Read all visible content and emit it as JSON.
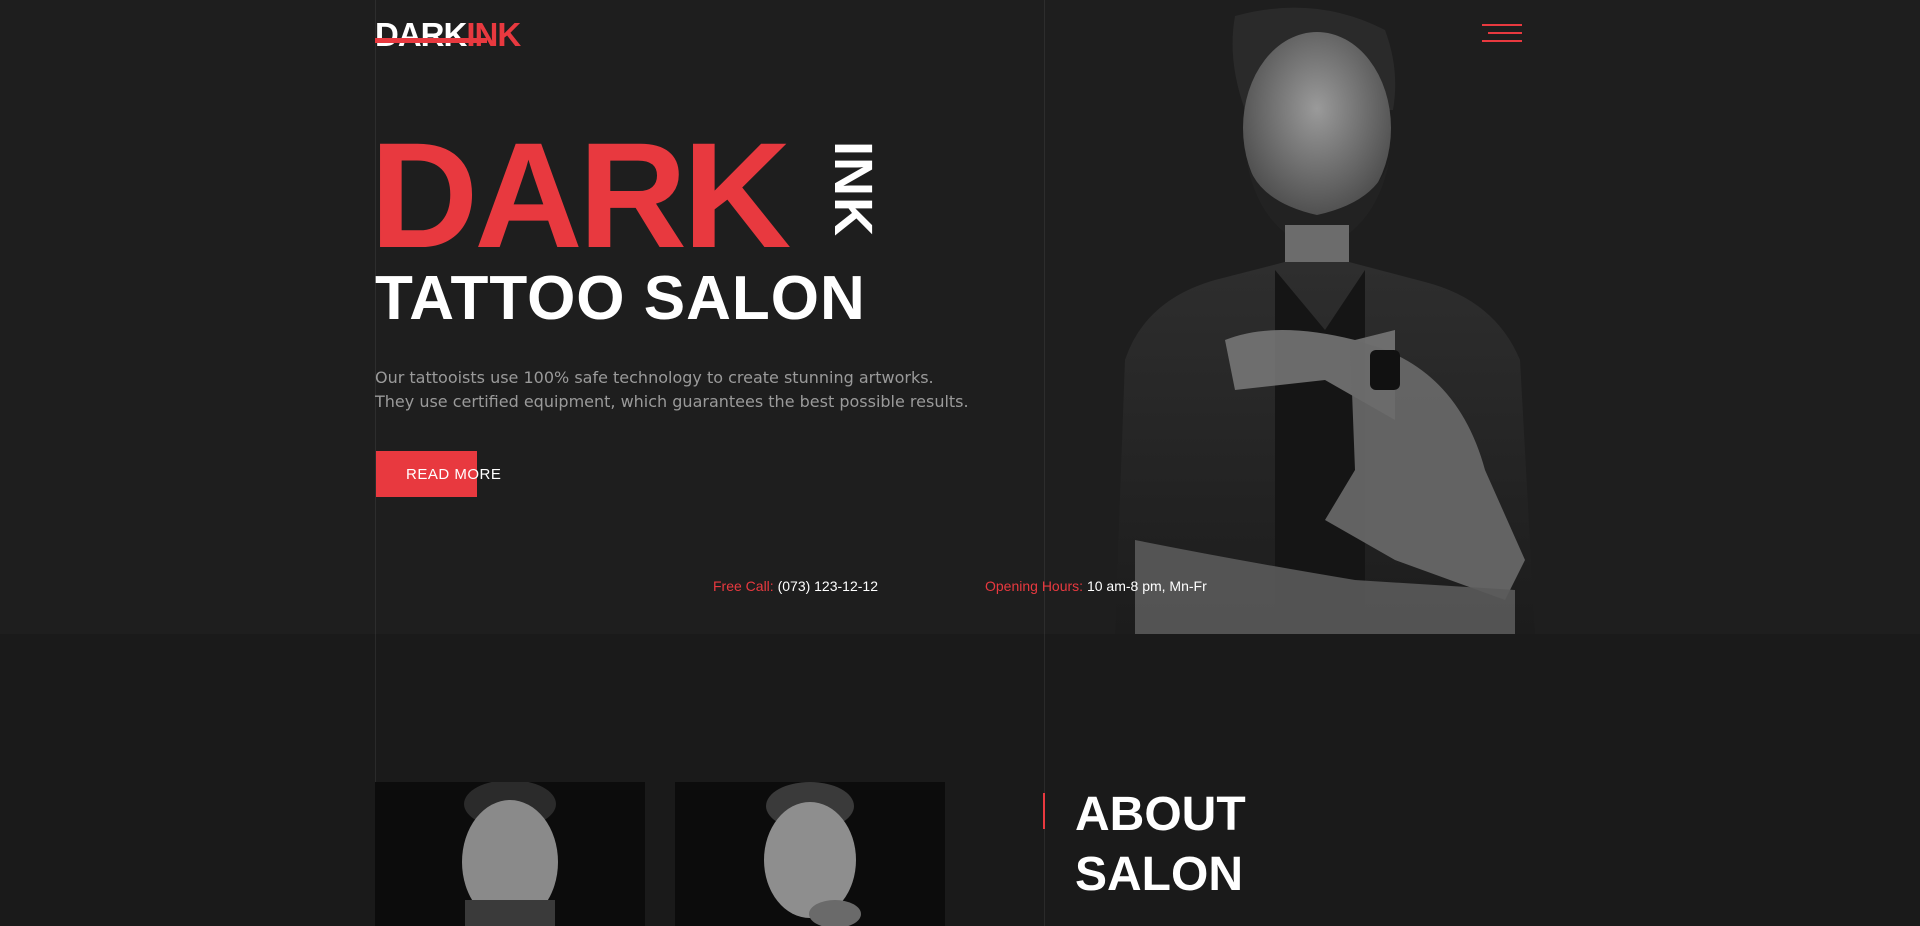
{
  "logo": {
    "part1": "DARK",
    "part2": "INK"
  },
  "hero": {
    "title_big": "DARK",
    "title_vertical": "INK",
    "subtitle": "TATTOO SALON",
    "description_line1": "Our tattooists use 100% safe technology to create stunning artworks.",
    "description_line2": "They use certified equipment, which guarantees the best possible results.",
    "cta_label": "READ MORE"
  },
  "contact": {
    "call_label": "Free Call:",
    "call_value": "(073) 123-12-12",
    "hours_label": "Opening Hours:",
    "hours_value": "10 am-8 pm, Mn-Fr"
  },
  "about": {
    "title_line1": "ABOUT",
    "title_line2": "SALON"
  },
  "icons": {
    "menu": "hamburger-menu-icon"
  },
  "colors": {
    "accent": "#e8393f",
    "background": "#1e1e1e",
    "background_lower": "#1a1a1a",
    "text_muted": "#9a9a9a"
  }
}
